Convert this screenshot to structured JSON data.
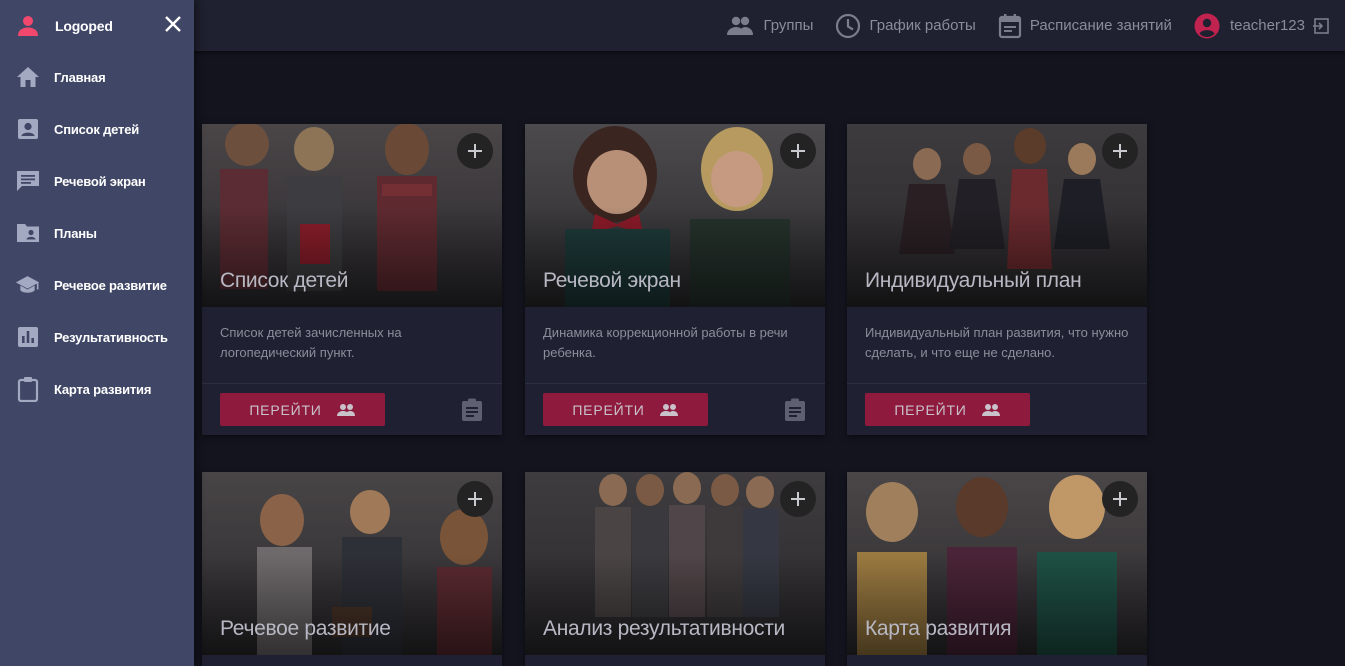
{
  "app": {
    "brand": "Logoped"
  },
  "topnav": {
    "groups": "Группы",
    "work_schedule": "График работы",
    "class_schedule": "Расписание занятий",
    "username": "teacher123"
  },
  "sidebar": {
    "items": [
      {
        "label": "Главная",
        "icon": "home-icon"
      },
      {
        "label": "Список детей",
        "icon": "contact-card-icon"
      },
      {
        "label": "Речевой экран",
        "icon": "chat-icon"
      },
      {
        "label": "Планы",
        "icon": "folder-user-icon"
      },
      {
        "label": "Речевое развитие",
        "icon": "school-cap-icon"
      },
      {
        "label": "Результативность",
        "icon": "bar-chart-icon"
      },
      {
        "label": "Карта развития",
        "icon": "clipboard-icon"
      }
    ]
  },
  "cards": [
    {
      "title": "Список детей",
      "description": "Список детей зачисленных на логопедический пункт.",
      "button": "ПЕРЕЙТИ"
    },
    {
      "title": "Речевой экран",
      "description": "Динамика коррекционной работы в речи ребенка.",
      "button": "ПЕРЕЙТИ"
    },
    {
      "title": "Индивидуальный план",
      "description": "Индивидуальный план развития, что нужно сделать, и что еще не сделано.",
      "button": "ПЕРЕЙТИ"
    },
    {
      "title": "Речевое развитие"
    },
    {
      "title": "Анализ результативности"
    },
    {
      "title": "Карта развития"
    }
  ],
  "colors": {
    "accent": "#8e1b3d",
    "sidebar": "#404766",
    "topbar": "#1f2030",
    "user_icon": "#c0234f"
  }
}
